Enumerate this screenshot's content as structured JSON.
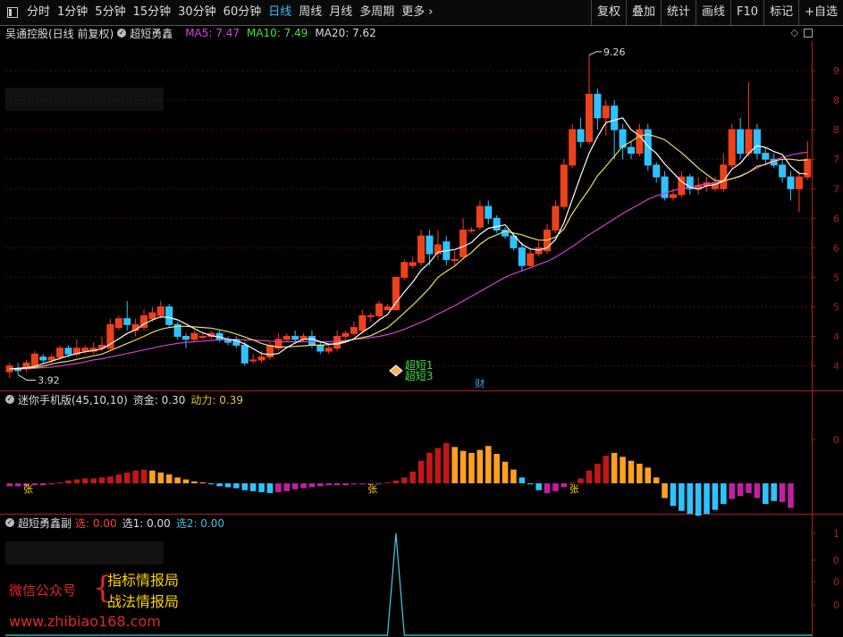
{
  "toolbar": {
    "periods": [
      "分时",
      "1分钟",
      "5分钟",
      "15分钟",
      "30分钟",
      "60分钟",
      "日线",
      "周线",
      "月线",
      "多周期",
      "更多"
    ],
    "active_period": "日线",
    "more_arrow": "›",
    "tools": [
      "复权",
      "叠加",
      "统计",
      "画线",
      "F10",
      "标记",
      "+自选"
    ]
  },
  "main_panel": {
    "stock": "吴通控股(日线 前复权)",
    "indicator": "超短勇鑫",
    "ma": [
      {
        "label": "MA5: 7.47",
        "color": "#e040e0"
      },
      {
        "label": "MA10: 7.49",
        "color": "#40e040"
      },
      {
        "label": "MA20: 7.62",
        "color": "#dddddd"
      }
    ],
    "high_label": "9.26",
    "low_label": "3.92",
    "signal_1": "超短1",
    "signal_2": "超短3",
    "finance_mark": "财",
    "axis_ticks": [
      "9",
      "8",
      "8",
      "7",
      "7",
      "6",
      "6",
      "5",
      "5",
      "4",
      "4"
    ]
  },
  "sub_panel_1": {
    "title": "迷你手机版(45,10,10)",
    "fund": "资金: 0.30",
    "power": "动力: 0.39",
    "axis_tick": "0",
    "zhang_label": "张"
  },
  "sub_panel_2": {
    "title": "超短勇鑫副",
    "xuan": "选: 0.00",
    "xuan1": "选1: 0.00",
    "xuan2": "选2: 0.00",
    "axis_ticks": [
      "1",
      "0",
      "0",
      "0"
    ]
  },
  "watermark": {
    "label": "微信公众号",
    "line1": "指标情报局",
    "line2": "战法情报局",
    "url": "www.zhibiao168.com"
  },
  "colors": {
    "up": "#ff3a1a",
    "up_fill": "#e8441c",
    "down": "#2ec2ff",
    "grid": "#5a0c0c",
    "axis": "#b81c1c",
    "ma5": "#ffffff",
    "ma10": "#e8e060",
    "ma20": "#d040d0"
  },
  "chart_data": {
    "type": "candlestick",
    "ylim": [
      3.6,
      9.5
    ],
    "candles": [
      [
        3.9,
        4.0,
        3.8,
        4.05
      ],
      [
        3.95,
        3.92,
        3.85,
        4.05
      ],
      [
        3.95,
        4.05,
        3.9,
        4.1
      ],
      [
        4.0,
        4.2,
        3.98,
        4.25
      ],
      [
        4.15,
        4.1,
        4.05,
        4.2
      ],
      [
        4.1,
        4.15,
        4.05,
        4.2
      ],
      [
        4.15,
        4.3,
        4.1,
        4.35
      ],
      [
        4.3,
        4.2,
        4.15,
        4.35
      ],
      [
        4.2,
        4.3,
        4.15,
        4.45
      ],
      [
        4.25,
        4.3,
        4.2,
        4.35
      ],
      [
        4.25,
        4.3,
        4.2,
        4.4
      ],
      [
        4.3,
        4.35,
        4.25,
        4.5
      ],
      [
        4.3,
        4.7,
        4.25,
        4.8
      ],
      [
        4.65,
        4.8,
        4.6,
        4.85
      ],
      [
        4.8,
        4.7,
        4.6,
        5.1
      ],
      [
        4.6,
        4.7,
        4.5,
        4.8
      ],
      [
        4.65,
        4.85,
        4.6,
        4.95
      ],
      [
        4.8,
        4.9,
        4.75,
        5.0
      ],
      [
        4.85,
        5.0,
        4.8,
        5.1
      ],
      [
        5.0,
        4.7,
        4.65,
        5.05
      ],
      [
        4.7,
        4.5,
        4.45,
        4.75
      ],
      [
        4.5,
        4.45,
        4.3,
        4.55
      ],
      [
        4.45,
        4.55,
        4.4,
        4.6
      ],
      [
        4.5,
        4.5,
        4.45,
        4.55
      ],
      [
        4.5,
        4.55,
        4.45,
        4.6
      ],
      [
        4.55,
        4.45,
        4.4,
        4.6
      ],
      [
        4.45,
        4.4,
        4.35,
        4.5
      ],
      [
        4.45,
        4.35,
        4.3,
        4.5
      ],
      [
        4.35,
        4.05,
        4.0,
        4.4
      ],
      [
        4.1,
        4.1,
        4.05,
        4.2
      ],
      [
        4.1,
        4.15,
        4.05,
        4.25
      ],
      [
        4.15,
        4.35,
        4.1,
        4.4
      ],
      [
        4.3,
        4.45,
        4.25,
        4.55
      ],
      [
        4.45,
        4.5,
        4.4,
        4.55
      ],
      [
        4.5,
        4.45,
        4.4,
        4.6
      ],
      [
        4.45,
        4.5,
        4.4,
        4.55
      ],
      [
        4.5,
        4.35,
        4.3,
        4.6
      ],
      [
        4.35,
        4.25,
        4.2,
        4.4
      ],
      [
        4.25,
        4.3,
        4.2,
        4.35
      ],
      [
        4.3,
        4.5,
        4.25,
        4.6
      ],
      [
        4.5,
        4.55,
        4.45,
        4.6
      ],
      [
        4.55,
        4.65,
        4.5,
        4.75
      ],
      [
        4.6,
        4.85,
        4.55,
        4.95
      ],
      [
        4.85,
        4.85,
        4.75,
        4.9
      ],
      [
        4.85,
        5.05,
        4.8,
        5.1
      ],
      [
        4.95,
        5.0,
        4.95,
        5.05
      ],
      [
        4.95,
        5.5,
        4.95,
        5.5
      ],
      [
        5.5,
        5.75,
        5.45,
        5.8
      ],
      [
        5.7,
        5.75,
        5.65,
        5.85
      ],
      [
        5.75,
        6.2,
        5.7,
        6.3
      ],
      [
        6.2,
        5.9,
        5.7,
        6.3
      ],
      [
        5.9,
        6.05,
        5.8,
        6.3
      ],
      [
        6.1,
        5.8,
        5.7,
        6.2
      ],
      [
        5.8,
        5.8,
        5.7,
        5.95
      ],
      [
        5.85,
        6.3,
        5.8,
        6.5
      ],
      [
        6.3,
        6.3,
        6.25,
        6.35
      ],
      [
        6.35,
        6.7,
        6.3,
        6.8
      ],
      [
        6.7,
        6.5,
        6.4,
        6.8
      ],
      [
        6.5,
        6.3,
        6.25,
        6.55
      ],
      [
        6.3,
        6.2,
        6.15,
        6.35
      ],
      [
        6.2,
        6.0,
        5.95,
        6.25
      ],
      [
        6.0,
        5.7,
        5.6,
        6.1
      ],
      [
        5.7,
        5.9,
        5.65,
        6.0
      ],
      [
        5.9,
        6.0,
        5.85,
        6.1
      ],
      [
        5.95,
        6.3,
        5.9,
        6.4
      ],
      [
        6.3,
        6.7,
        6.25,
        6.8
      ],
      [
        6.7,
        7.4,
        6.65,
        7.5
      ],
      [
        7.4,
        8.0,
        7.35,
        8.1
      ],
      [
        8.0,
        7.8,
        7.7,
        8.2
      ],
      [
        7.8,
        8.6,
        7.75,
        9.26
      ],
      [
        8.6,
        8.2,
        8.0,
        8.7
      ],
      [
        8.2,
        8.4,
        7.9,
        8.5
      ],
      [
        8.4,
        8.0,
        7.5,
        8.5
      ],
      [
        8.0,
        7.7,
        7.5,
        8.1
      ],
      [
        7.7,
        7.6,
        7.5,
        7.8
      ],
      [
        7.6,
        8.0,
        7.55,
        8.1
      ],
      [
        8.0,
        7.4,
        7.3,
        8.1
      ],
      [
        7.4,
        7.2,
        7.1,
        7.45
      ],
      [
        7.2,
        6.85,
        6.8,
        7.3
      ],
      [
        6.85,
        6.9,
        6.8,
        7.0
      ],
      [
        6.9,
        7.2,
        6.85,
        7.3
      ],
      [
        7.2,
        7.0,
        6.9,
        7.25
      ],
      [
        7.0,
        7.05,
        6.9,
        7.2
      ],
      [
        7.05,
        7.1,
        6.95,
        7.2
      ],
      [
        7.0,
        7.1,
        6.95,
        7.2
      ],
      [
        7.0,
        7.4,
        6.95,
        7.6
      ],
      [
        7.4,
        8.0,
        7.35,
        8.1
      ],
      [
        8.0,
        7.6,
        7.5,
        8.2
      ],
      [
        7.6,
        8.0,
        7.55,
        8.8
      ],
      [
        8.0,
        7.6,
        7.5,
        8.1
      ],
      [
        7.6,
        7.5,
        7.4,
        7.7
      ],
      [
        7.5,
        7.4,
        7.35,
        7.6
      ],
      [
        7.4,
        7.2,
        7.1,
        7.5
      ],
      [
        7.2,
        7.0,
        6.8,
        7.3
      ],
      [
        7.0,
        7.2,
        6.6,
        7.3
      ],
      [
        7.2,
        7.5,
        7.15,
        7.8
      ]
    ],
    "ma5": [
      3.95,
      3.96,
      3.97,
      3.99,
      4.04,
      4.08,
      4.13,
      4.17,
      4.21,
      4.24,
      4.26,
      4.29,
      4.37,
      4.46,
      4.55,
      4.61,
      4.71,
      4.78,
      4.83,
      4.82,
      4.78,
      4.71,
      4.63,
      4.56,
      4.51,
      4.49,
      4.45,
      4.43,
      4.37,
      4.29,
      4.21,
      4.19,
      4.21,
      4.31,
      4.39,
      4.45,
      4.46,
      4.41,
      4.37,
      4.37,
      4.4,
      4.46,
      4.57,
      4.66,
      4.78,
      4.87,
      5.07,
      5.25,
      5.42,
      5.62,
      5.75,
      5.93,
      5.95,
      5.97,
      6.02,
      6.09,
      6.23,
      6.33,
      6.36,
      6.39,
      6.22,
      6.06,
      5.98,
      5.96,
      6.0,
      6.14,
      6.42,
      6.82,
      7.22,
      7.6,
      7.88,
      8.12,
      8.16,
      8.2,
      8.0,
      7.9,
      7.72,
      7.6,
      7.42,
      7.27,
      7.12,
      7.03,
      6.99,
      7.05,
      7.07,
      7.13,
      7.33,
      7.43,
      7.6,
      7.73,
      7.7,
      7.63,
      7.58,
      7.38,
      7.26,
      7.25
    ],
    "ma10": [
      3.95,
      3.95,
      3.96,
      3.97,
      4.0,
      4.03,
      4.06,
      4.08,
      4.11,
      4.14,
      4.17,
      4.2,
      4.26,
      4.32,
      4.38,
      4.44,
      4.5,
      4.57,
      4.62,
      4.65,
      4.67,
      4.67,
      4.66,
      4.65,
      4.64,
      4.61,
      4.58,
      4.54,
      4.49,
      4.44,
      4.38,
      4.34,
      4.32,
      4.32,
      4.33,
      4.34,
      4.35,
      4.35,
      4.36,
      4.39,
      4.42,
      4.45,
      4.48,
      4.51,
      4.58,
      4.65,
      4.77,
      4.9,
      5.03,
      5.17,
      5.32,
      5.5,
      5.6,
      5.69,
      5.82,
      5.92,
      6.06,
      6.16,
      6.22,
      6.28,
      6.25,
      6.22,
      6.17,
      6.13,
      6.13,
      6.18,
      6.32,
      6.58,
      6.79,
      6.99,
      7.22,
      7.38,
      7.55,
      7.72,
      7.8,
      7.89,
      7.92,
      7.88,
      7.83,
      7.72,
      7.61,
      7.48,
      7.35,
      7.24,
      7.14,
      7.13,
      7.17,
      7.21,
      7.28,
      7.38,
      7.41,
      7.47,
      7.5,
      7.5,
      7.48,
      7.49
    ],
    "ma20": [
      3.95,
      3.95,
      3.95,
      3.96,
      3.97,
      3.98,
      4.0,
      4.02,
      4.04,
      4.07,
      4.1,
      4.12,
      4.15,
      4.18,
      4.21,
      4.24,
      4.27,
      4.3,
      4.33,
      4.36,
      4.38,
      4.4,
      4.41,
      4.42,
      4.43,
      4.44,
      4.44,
      4.44,
      4.44,
      4.44,
      4.43,
      4.42,
      4.41,
      4.41,
      4.41,
      4.41,
      4.41,
      4.41,
      4.41,
      4.42,
      4.43,
      4.45,
      4.46,
      4.48,
      4.5,
      4.53,
      4.57,
      4.62,
      4.68,
      4.74,
      4.8,
      4.88,
      4.95,
      5.02,
      5.1,
      5.18,
      5.26,
      5.34,
      5.42,
      5.5,
      5.56,
      5.61,
      5.66,
      5.72,
      5.77,
      5.84,
      5.93,
      6.02,
      6.12,
      6.22,
      6.31,
      6.4,
      6.49,
      6.58,
      6.66,
      6.74,
      6.82,
      6.88,
      6.92,
      6.97,
      7.0,
      7.03,
      7.06,
      7.08,
      7.1,
      7.13,
      7.17,
      7.22,
      7.28,
      7.35,
      7.42,
      7.48,
      7.53,
      7.57,
      7.6,
      7.62
    ],
    "sub1_bars": [
      -0.3,
      -0.3,
      -0.3,
      -0.2,
      -0.2,
      -0.1,
      0.1,
      0.3,
      0.4,
      0.5,
      0.5,
      0.6,
      0.7,
      0.9,
      1.1,
      1.3,
      1.4,
      1.3,
      1.1,
      0.9,
      0.6,
      0.4,
      0.2,
      0.1,
      -0.1,
      -0.3,
      -0.4,
      -0.5,
      -0.7,
      -0.8,
      -0.9,
      -1.0,
      -0.9,
      -0.8,
      -0.6,
      -0.5,
      -0.4,
      -0.3,
      -0.2,
      -0.2,
      -0.2,
      -0.1,
      -0.1,
      -0.1,
      -0.1,
      0.1,
      0.3,
      0.6,
      1.2,
      2.3,
      3.1,
      3.6,
      4.1,
      3.7,
      3.3,
      3.1,
      3.4,
      3.8,
      3.0,
      2.2,
      1.4,
      0.6,
      -0.1,
      -0.7,
      -1.0,
      -0.8,
      -0.4,
      0.1,
      0.5,
      1.3,
      2.0,
      2.8,
      3.1,
      2.7,
      2.3,
      2.0,
      1.6,
      0.6,
      -1.5,
      -2.3,
      -2.8,
      -3.1,
      -3.3,
      -3.1,
      -2.7,
      -2.1,
      -1.6,
      -1.3,
      -1.0,
      -1.5,
      -2.1,
      -1.8,
      -1.9,
      -2.5
    ],
    "sub1_colors": [
      "m",
      "m",
      "m",
      "m",
      "m",
      "m",
      "r",
      "r",
      "r",
      "r",
      "r",
      "r",
      "r",
      "r",
      "r",
      "r",
      "r",
      "y",
      "y",
      "y",
      "y",
      "y",
      "y",
      "y",
      "b",
      "b",
      "b",
      "b",
      "b",
      "b",
      "b",
      "b",
      "m",
      "m",
      "m",
      "m",
      "m",
      "m",
      "m",
      "m",
      "m",
      "m",
      "m",
      "m",
      "m",
      "r",
      "r",
      "r",
      "r",
      "r",
      "r",
      "r",
      "r",
      "y",
      "y",
      "y",
      "y",
      "y",
      "y",
      "y",
      "y",
      "b",
      "b",
      "b",
      "m",
      "m",
      "m",
      "r",
      "r",
      "r",
      "r",
      "r",
      "y",
      "y",
      "y",
      "y",
      "y",
      "y",
      "y",
      "b",
      "b",
      "b",
      "b",
      "b",
      "b",
      "b",
      "m",
      "m",
      "m",
      "m",
      "b",
      "b",
      "m",
      "m",
      "b",
      "m"
    ],
    "sub2_peak_index": 46,
    "sub2_peak_value": 1
  }
}
